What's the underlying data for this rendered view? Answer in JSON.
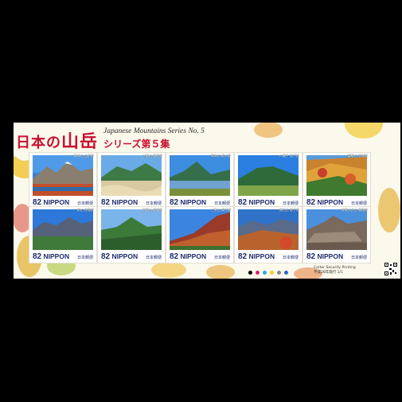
{
  "title": {
    "jp_a": "日本の",
    "jp_b": "山岳",
    "en": "Japanese Mountains Series No. 5",
    "sub": "シリーズ第５集"
  },
  "stamps": [
    {
      "caption": "鳥海山 山形県",
      "denom": "82",
      "country": "NIPPON",
      "post": "日本郵便"
    },
    {
      "caption": "三瓶山 島根県",
      "denom": "82",
      "country": "NIPPON",
      "post": "日本郵便"
    },
    {
      "caption": "男体山 栃木県",
      "denom": "82",
      "country": "NIPPON",
      "post": "日本郵便"
    },
    {
      "caption": "八幡平 岩手県",
      "denom": "82",
      "country": "NIPPON",
      "post": "日本郵便"
    },
    {
      "caption": "栗駒山 宮城県",
      "denom": "82",
      "country": "NIPPON",
      "post": "日本郵便"
    },
    {
      "caption": "剣山 徳島県",
      "denom": "82",
      "country": "NIPPON",
      "post": "日本郵便"
    },
    {
      "caption": "石鎚山 愛媛県",
      "denom": "82",
      "country": "NIPPON",
      "post": "日本郵便"
    },
    {
      "caption": "三原山 東京都",
      "denom": "82",
      "country": "NIPPON",
      "post": "日本郵便"
    },
    {
      "caption": "焼石岳 岩手県",
      "denom": "82",
      "country": "NIPPON",
      "post": "日本郵便"
    },
    {
      "caption": "安達太良山 福島県",
      "denom": "82",
      "country": "NIPPON",
      "post": "日本郵便"
    }
  ],
  "printer": {
    "line1": "Cartor Security Printing",
    "line2": "平成28年発行 1/1"
  },
  "colors": {
    "title_red": "#c8102e",
    "denom_blue": "#1d2b6b",
    "registration": [
      "#000000",
      "#d8246c",
      "#1fb0e0",
      "#f4d21c",
      "#8a8a8a",
      "#2a66c8"
    ]
  }
}
